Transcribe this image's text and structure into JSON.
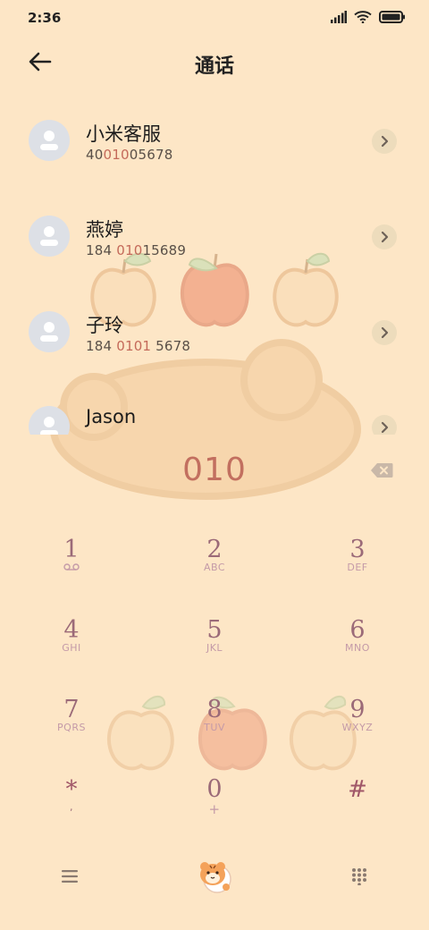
{
  "status": {
    "time": "2:36"
  },
  "header": {
    "title": "通话"
  },
  "contacts": [
    {
      "name": "小米客服",
      "number_pre": "40",
      "number_hl": "010",
      "number_post": "05678"
    },
    {
      "name": "燕婷",
      "number_pre": "184 ",
      "number_hl": "010",
      "number_post": "15689"
    },
    {
      "name": "子玲",
      "number_pre": "184 ",
      "number_hl": "0101",
      "number_post": " 5678"
    },
    {
      "name": "Jason",
      "number_pre": "",
      "number_hl": "",
      "number_post": ""
    }
  ],
  "dialer": {
    "input": "010"
  },
  "keys": [
    {
      "digit": "1",
      "letters": ""
    },
    {
      "digit": "2",
      "letters": "ABC"
    },
    {
      "digit": "3",
      "letters": "DEF"
    },
    {
      "digit": "4",
      "letters": "GHI"
    },
    {
      "digit": "5",
      "letters": "JKL"
    },
    {
      "digit": "6",
      "letters": "MNO"
    },
    {
      "digit": "7",
      "letters": "PQRS"
    },
    {
      "digit": "8",
      "letters": "TUV"
    },
    {
      "digit": "9",
      "letters": "WXYZ"
    },
    {
      "digit": "*",
      "letters": ","
    },
    {
      "digit": "0",
      "letters": "+"
    },
    {
      "digit": "#",
      "letters": ""
    }
  ],
  "icons": {
    "back": "arrow-left-icon",
    "chevron": "chevron-right-icon",
    "delete": "backspace-icon",
    "menu": "menu-icon",
    "dial": "tiger-dial-icon",
    "keypad": "keypad-grid-icon",
    "voicemail": "voicemail-icon"
  },
  "colors": {
    "background": "#fde6c6",
    "accent": "#c26f5f",
    "key_digit": "#9b6a78"
  }
}
